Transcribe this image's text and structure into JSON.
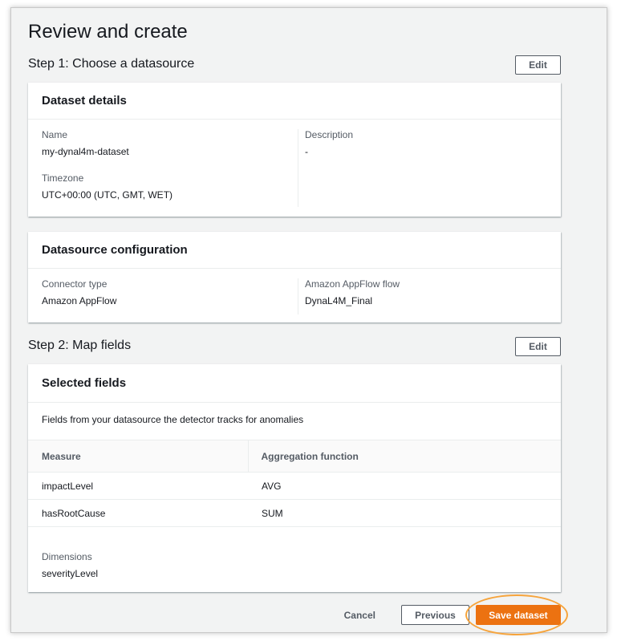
{
  "page": {
    "title": "Review and create"
  },
  "step1": {
    "title": "Step 1: Choose a datasource",
    "edit_label": "Edit",
    "dataset_details": {
      "header": "Dataset details",
      "name_label": "Name",
      "name_value": "my-dynal4m-dataset",
      "timezone_label": "Timezone",
      "timezone_value": "UTC+00:00 (UTC, GMT, WET)",
      "description_label": "Description",
      "description_value": "-"
    },
    "datasource_configuration": {
      "header": "Datasource configuration",
      "connector_label": "Connector type",
      "connector_value": "Amazon AppFlow",
      "flow_label": "Amazon AppFlow flow",
      "flow_value": "DynaL4M_Final"
    }
  },
  "step2": {
    "title": "Step 2: Map fields",
    "edit_label": "Edit",
    "selected_fields": {
      "header": "Selected fields",
      "description": "Fields from your datasource the detector tracks for anomalies",
      "columns": [
        "Measure",
        "Aggregation function"
      ],
      "rows": [
        {
          "measure": "impactLevel",
          "aggregation": "AVG"
        },
        {
          "measure": "hasRootCause",
          "aggregation": "SUM"
        }
      ],
      "dimensions_label": "Dimensions",
      "dimensions_value": "severityLevel"
    }
  },
  "footer": {
    "cancel_label": "Cancel",
    "previous_label": "Previous",
    "save_label": "Save dataset"
  },
  "colors": {
    "primary": "#ec7211",
    "highlight": "#f6a43c",
    "background": "#f2f3f3"
  }
}
